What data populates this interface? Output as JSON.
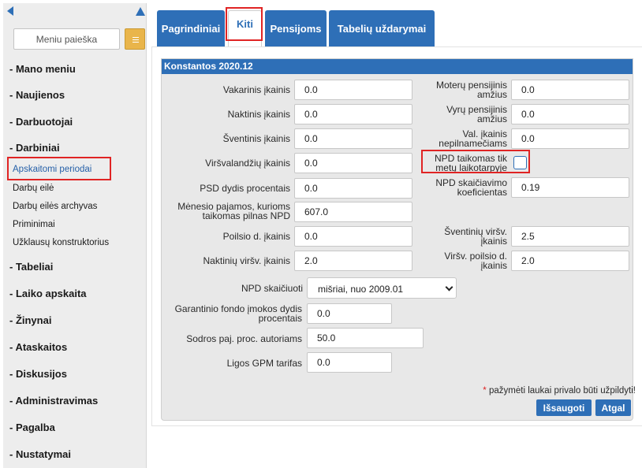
{
  "sidebar": {
    "search_placeholder": "Meniu paieška",
    "items": [
      {
        "label": "- Mano meniu"
      },
      {
        "label": "- Naujienos"
      },
      {
        "label": "- Darbuotojai"
      },
      {
        "label": "- Darbiniai"
      },
      {
        "label": "Apskaitomi periodai",
        "active": true
      },
      {
        "label": "Darbų eilė"
      },
      {
        "label": "Darbų eilės archyvas"
      },
      {
        "label": "Priminimai"
      },
      {
        "label": "Užklausų konstruktorius"
      },
      {
        "label": "- Tabeliai"
      },
      {
        "label": "- Laiko apskaita"
      },
      {
        "label": "- Žinynai"
      },
      {
        "label": "- Ataskaitos"
      },
      {
        "label": "- Diskusijos"
      },
      {
        "label": "- Administravimas"
      },
      {
        "label": "- Pagalba"
      },
      {
        "label": "- Nustatymai"
      }
    ]
  },
  "tabs": [
    {
      "label": "Pagrindiniai"
    },
    {
      "label": "Kiti",
      "active": true
    },
    {
      "label": "Pensijoms"
    },
    {
      "label": "Tabelių uždarymai"
    }
  ],
  "panel": {
    "title": "Konstantos 2020.12",
    "left_fields": [
      {
        "label": "Vakarinis įkainis",
        "value": "0.0"
      },
      {
        "label": "Naktinis įkainis",
        "value": "0.0"
      },
      {
        "label": "Šventinis įkainis",
        "value": "0.0"
      },
      {
        "label": "Viršvalandžių įkainis",
        "value": "0.0"
      },
      {
        "label": "PSD dydis procentais",
        "value": "0.0"
      },
      {
        "label_lines": [
          "Mėnesio pajamos, kurioms",
          "taikomas pilnas NPD"
        ],
        "value": "607.0"
      },
      {
        "label": "Poilsio d. įkainis",
        "value": "0.0"
      },
      {
        "label": "Naktinių viršv. įkainis",
        "value": "2.0"
      }
    ],
    "right_fields": [
      {
        "label_lines": [
          "Moterų pensijinis",
          "amžius"
        ],
        "value": "0.0"
      },
      {
        "label_lines": [
          "Vyrų pensijinis",
          "amžius"
        ],
        "value": "0.0"
      },
      {
        "label_lines": [
          "Val. įkainis",
          "nepilnamečiams"
        ],
        "value": "0.0"
      },
      {
        "label_lines": [
          "NPD taikomas tik",
          "metų laikotarpyje"
        ],
        "checkbox": true
      },
      {
        "label_lines": [
          "NPD skaičiavimo",
          "koeficientas"
        ],
        "value": "0.19"
      },
      {
        "label_lines": [
          "Šventinių viršv.",
          "įkainis"
        ],
        "value": "2.5"
      },
      {
        "label_lines": [
          "Viršv. poilsio d.",
          "įkainis"
        ],
        "value": "2.0"
      }
    ],
    "npd_calc": {
      "label": "NPD skaičiuoti",
      "selected": "mišriai, nuo 2009.01"
    },
    "bottom_fields": [
      {
        "label_lines": [
          "Garantinio fondo įmokos dydis",
          "procentais"
        ],
        "value": "0.0"
      },
      {
        "label": "Sodros paj. proc. autoriams",
        "value": "50.0"
      },
      {
        "label": "Ligos GPM tarifas",
        "value": "0.0"
      }
    ],
    "required_note": "pažymėti laukai privalo būti užpildyti!",
    "save_label": "Išsaugoti",
    "back_label": "Atgal"
  }
}
